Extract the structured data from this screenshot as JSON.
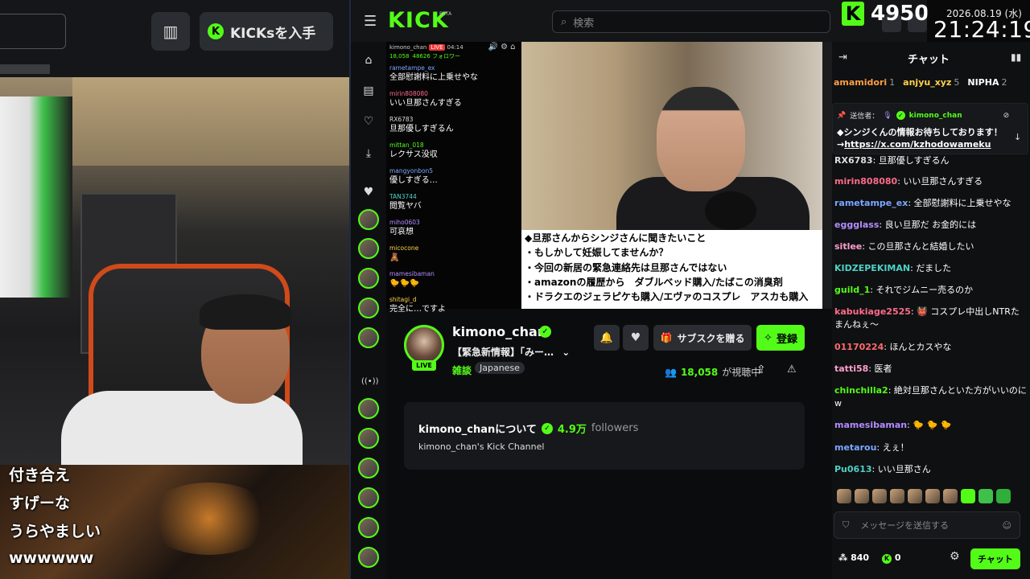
{
  "left_overlay": {
    "kicks_button": "KICKsを入手",
    "subtitles": [
      "付き合え",
      "すげーな",
      "うらやましい",
      "wwwwww"
    ]
  },
  "header": {
    "logo": "KICK",
    "beta": "BETA",
    "search_placeholder": "検索",
    "kicks_count": "4950",
    "date": "2026.08.19 (水)",
    "time": "21:24:19"
  },
  "video_chat": {
    "streamer": "kimono_chan",
    "live": "LIVE",
    "uptime": "04:14",
    "viewers": "18,058",
    "followers": "48626 フォロワー",
    "controls": [
      "読み上げ",
      "設定",
      "ホーム"
    ],
    "messages": [
      {
        "user": "rametampe_ex",
        "color": "#7aa7ff",
        "text": "全部慰謝料に上乗せやな"
      },
      {
        "user": "mirin808080",
        "color": "#ff6b8a",
        "text": "いい旦那さんすぎる"
      },
      {
        "user": "RX6783",
        "color": "#dddddd",
        "text": "旦那優しすぎるん"
      },
      {
        "user": "mittan_018",
        "color": "#53fc18",
        "text": "レクサス没収"
      },
      {
        "user": "mangyonbon5",
        "color": "#7aa7ff",
        "text": "優しすぎる…"
      },
      {
        "user": "TAN3744",
        "color": "#4fd1c5",
        "text": "閲覧ヤバ"
      },
      {
        "user": "miho0603",
        "color": "#b38cff",
        "text": "可哀想"
      },
      {
        "user": "micocone",
        "color": "#ffd24a",
        "text": "🧸"
      },
      {
        "user": "mamesibaman",
        "color": "#b38cff",
        "text": "🐤🐤🐤"
      },
      {
        "user": "shitagi_d",
        "color": "#ffd24a",
        "text": "完全に…ですよ"
      }
    ]
  },
  "video_text": {
    "lines": [
      "◆旦那さんからシンジさんに聞きたいこと",
      "・もしかして妊娠してませんか？",
      "・今回の新居の緊急連絡先は旦那さんではない",
      "・amazonの履歴から　ダブルベッド購入/たばこの消臭剤",
      "・ドラクエのジェラピケも購入/エヴァのコスプレ　アスカも購入"
    ]
  },
  "channel": {
    "name": "kimono_chan",
    "live": "LIVE",
    "title": "【緊急新情報】「みー…",
    "category": "雑談",
    "tag": "Japanese",
    "gift_label": "サブスクを贈る",
    "follow_label": "登録",
    "viewers": "18,058",
    "viewers_suffix": "が視聴中",
    "about_title": "kimono_chanについて",
    "about_followers": "4.9万",
    "about_followers_label": "followers",
    "about_desc": "kimono_chan's Kick Channel"
  },
  "chat": {
    "title": "チャット",
    "leaders": [
      {
        "user": "amamidori",
        "count": "1",
        "color": "#ff9f43"
      },
      {
        "user": "anjyu_xyz",
        "count": "5",
        "color": "#ffd24a"
      },
      {
        "user": "NIPHA",
        "count": "2",
        "color": "#ffffff"
      }
    ],
    "pinned_label": "送信者：",
    "pinned_user": "kimono_chan",
    "pinned_text": "◆シンジくんの情報お待ちしております！→",
    "pinned_link": "https://x.com/kzhodowameku",
    "messages": [
      {
        "user": "RX6783",
        "color": "#dddddd",
        "text": "旦那優しすぎるん"
      },
      {
        "user": "mirin808080",
        "color": "#ff6b8a",
        "text": "いい旦那さんすぎる"
      },
      {
        "user": "rametampe_ex",
        "color": "#7aa7ff",
        "text": "全部慰謝料に上乗せやな"
      },
      {
        "user": "eggglass",
        "color": "#b38cff",
        "text": "良い旦那だ お金的には"
      },
      {
        "user": "sitlee",
        "color": "#ff9fd1",
        "text": "この旦那さんと結婚したい"
      },
      {
        "user": "KIDZEPEKIMAN",
        "color": "#4fd1c5",
        "text": "だました"
      },
      {
        "user": "guild_1",
        "color": "#53fc18",
        "text": "それでジムニー売るのか"
      },
      {
        "user": "kabukiage2525",
        "color": "#ff6b8a",
        "text": "👹 コスプレ中出しNTRたまんねぇ〜"
      },
      {
        "user": "01170224",
        "color": "#ff6b6b",
        "text": "ほんとカスやな"
      },
      {
        "user": "tatti58",
        "color": "#ff9fd1",
        "text": "医者"
      },
      {
        "user": "chinchilla2",
        "color": "#53fc18",
        "text": "絶対旦那さんといた方がいいのにw"
      },
      {
        "user": "mamesibaman",
        "color": "#b38cff",
        "text": "🐤 🐤 🐤"
      },
      {
        "user": "metarou",
        "color": "#7aa7ff",
        "text": "えぇ！"
      },
      {
        "user": "Pu0613",
        "color": "#4fd1c5",
        "text": "いい旦那さん"
      }
    ],
    "input_placeholder": "メッセージを送信する",
    "points": "840",
    "kicks": "0",
    "send_label": "チャット"
  }
}
